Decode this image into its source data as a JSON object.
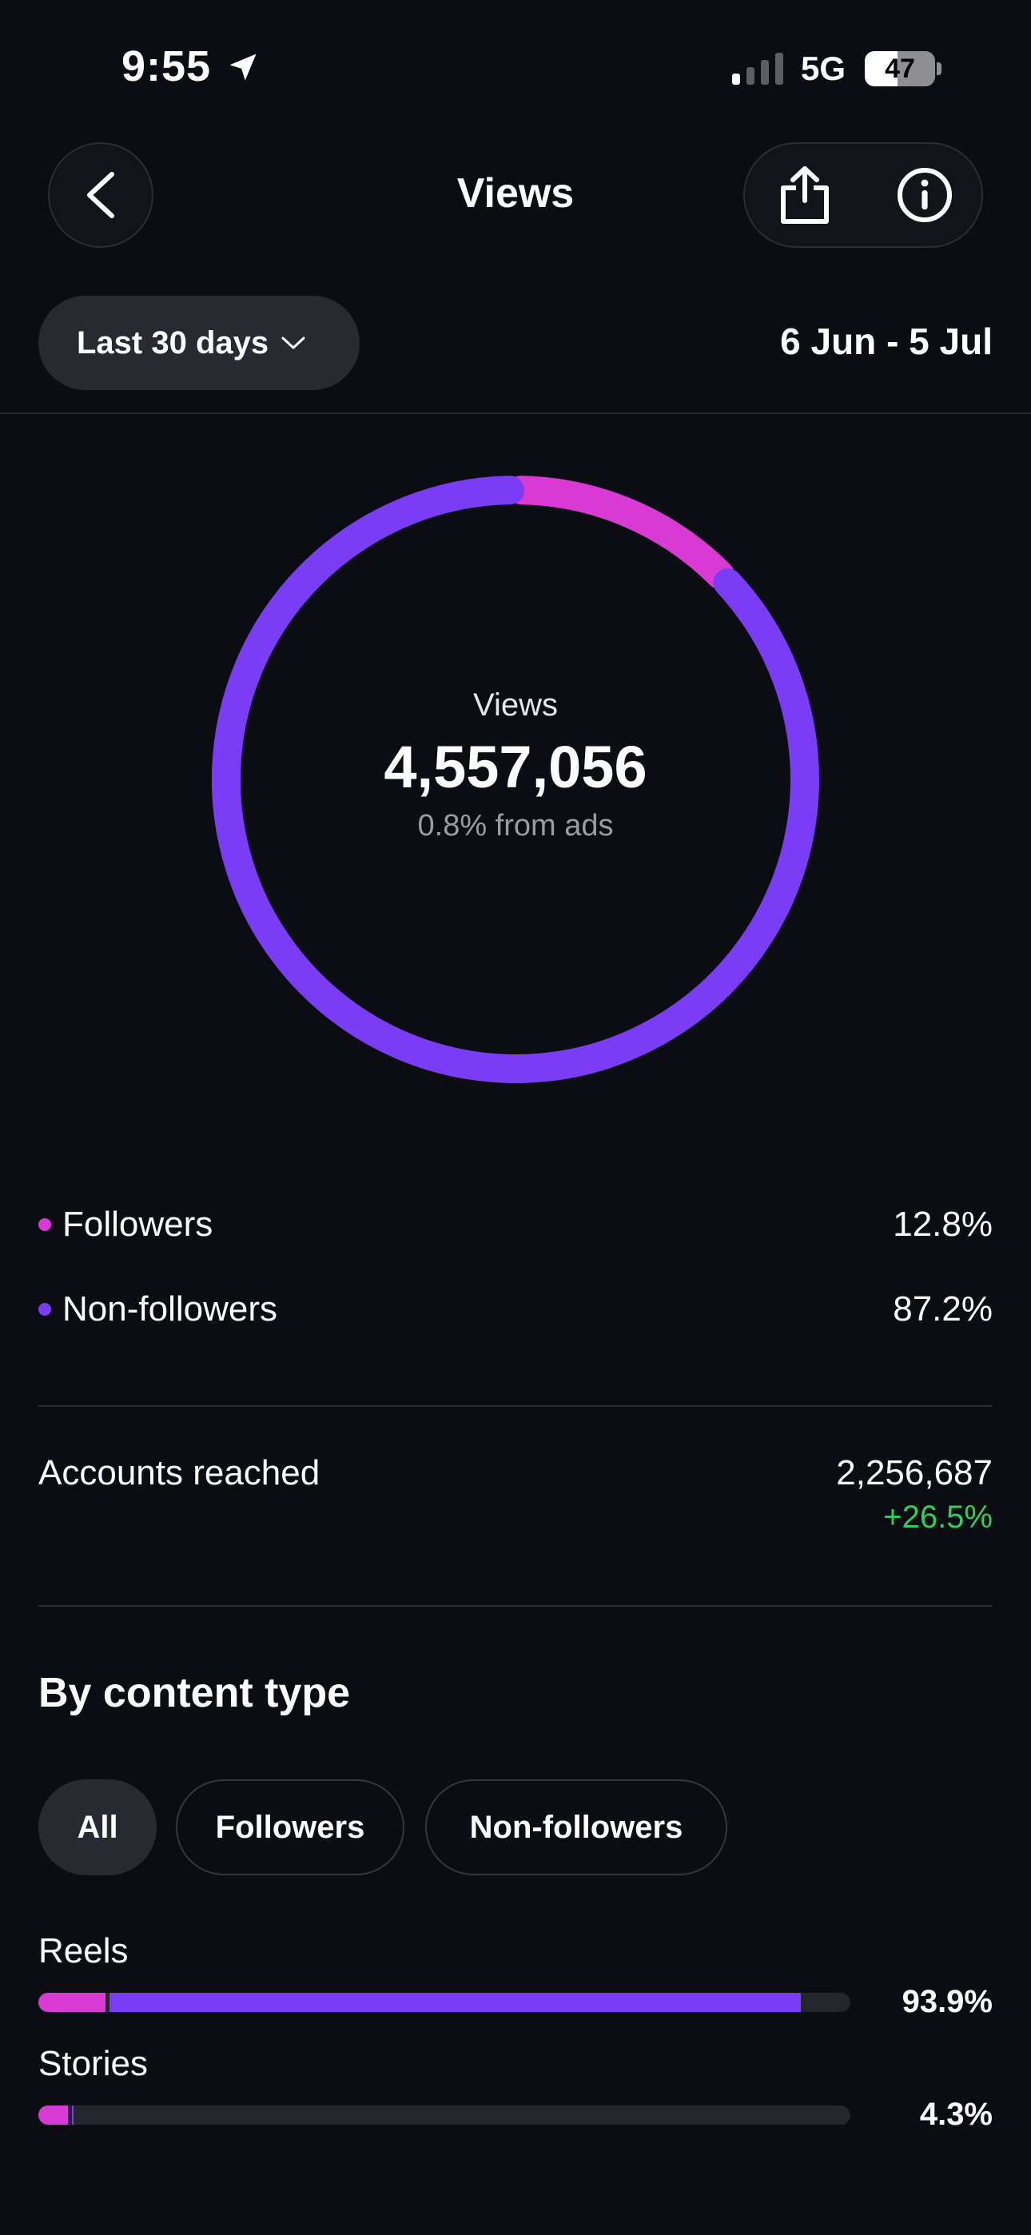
{
  "status_bar": {
    "time": "9:55",
    "network": "5G",
    "battery": "47",
    "battery_level": 0.47,
    "location_icon": "location-arrow-icon",
    "signal_icon": "cellular-signal-icon"
  },
  "header": {
    "title": "Views",
    "back_icon": "chevron-left-icon",
    "share_icon": "share-icon",
    "info_icon": "info-icon"
  },
  "filter": {
    "period_label": "Last 30 days",
    "date_range": "6 Jun - 5 Jul"
  },
  "summary": {
    "label": "Views",
    "value": "4,557,056",
    "ads_note": "0.8% from ads"
  },
  "colors": {
    "followers": "#d93ad3",
    "non_followers": "#7b3cf5",
    "positive": "#2fce5e",
    "track": "#23262d"
  },
  "audience": [
    {
      "name": "Followers",
      "percent": "12.8%",
      "value": 12.8
    },
    {
      "name": "Non-followers",
      "percent": "87.2%",
      "value": 87.2
    }
  ],
  "accounts_reached": {
    "label": "Accounts reached",
    "value": "2,256,687",
    "change": "+26.5%"
  },
  "content_type": {
    "title": "By content type",
    "tabs": [
      {
        "label": "All",
        "selected": true
      },
      {
        "label": "Followers",
        "selected": false
      },
      {
        "label": "Non-followers",
        "selected": false
      }
    ],
    "rows": [
      {
        "label": "Reels",
        "percent": "93.9%",
        "total": 93.9,
        "followers_share": 8.3
      },
      {
        "label": "Stories",
        "percent": "4.3%",
        "total": 4.3,
        "followers_share": 3.6
      }
    ]
  }
}
